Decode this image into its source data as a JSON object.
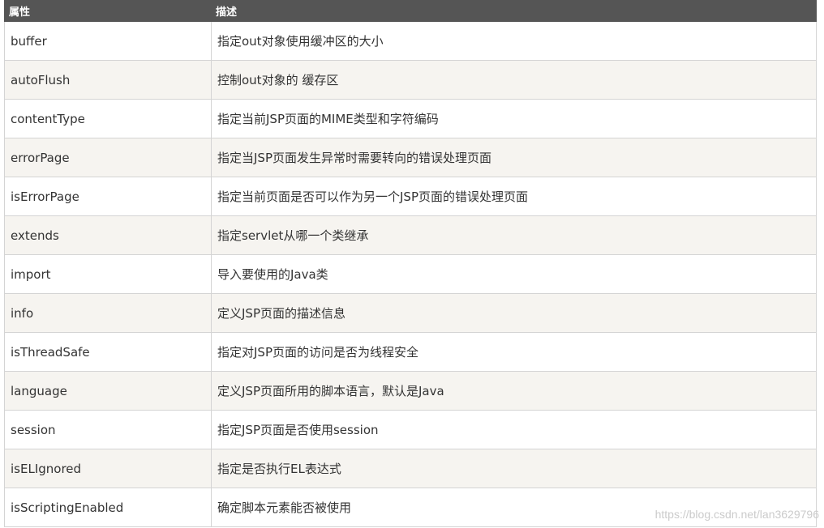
{
  "table": {
    "headers": [
      "属性",
      "描述"
    ],
    "rows": [
      {
        "attr": "buffer",
        "desc": "指定out对象使用缓冲区的大小"
      },
      {
        "attr": "autoFlush",
        "desc": "控制out对象的 缓存区"
      },
      {
        "attr": "contentType",
        "desc": "指定当前JSP页面的MIME类型和字符编码"
      },
      {
        "attr": "errorPage",
        "desc": "指定当JSP页面发生异常时需要转向的错误处理页面"
      },
      {
        "attr": "isErrorPage",
        "desc": "指定当前页面是否可以作为另一个JSP页面的错误处理页面"
      },
      {
        "attr": "extends",
        "desc": "指定servlet从哪一个类继承"
      },
      {
        "attr": "import",
        "desc": "导入要使用的Java类"
      },
      {
        "attr": "info",
        "desc": "定义JSP页面的描述信息"
      },
      {
        "attr": "isThreadSafe",
        "desc": "指定对JSP页面的访问是否为线程安全"
      },
      {
        "attr": "language",
        "desc": "定义JSP页面所用的脚本语言，默认是Java"
      },
      {
        "attr": "session",
        "desc": "指定JSP页面是否使用session"
      },
      {
        "attr": "isELIgnored",
        "desc": "指定是否执行EL表达式"
      },
      {
        "attr": "isScriptingEnabled",
        "desc": "确定脚本元素能否被使用"
      }
    ]
  },
  "watermark": "https://blog.csdn.net/lan3629796",
  "colors": {
    "header_bg": "#555555",
    "header_text": "#ffffff",
    "row_alt_bg": "#f6f4f0",
    "border": "#d4d4d4",
    "text": "#333333"
  }
}
